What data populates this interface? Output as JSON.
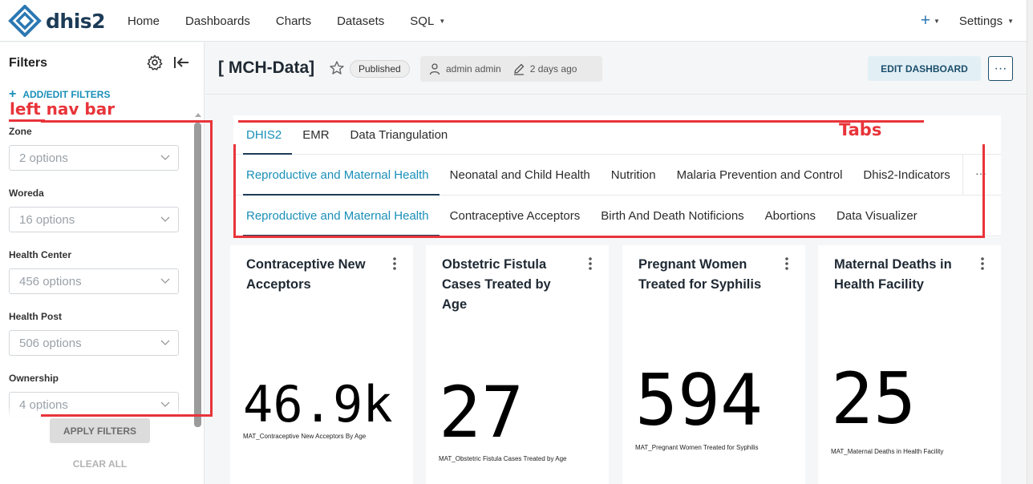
{
  "app": {
    "logo_text": "dhis2",
    "nav": [
      "Home",
      "Dashboards",
      "Charts",
      "Datasets",
      "SQL"
    ],
    "plus_label": "+",
    "settings_label": "Settings"
  },
  "sidebar": {
    "title": "Filters",
    "add_filters_label": "ADD/EDIT FILTERS",
    "annotation": "left nav bar",
    "filters": [
      {
        "label": "Zone",
        "value": "2 options"
      },
      {
        "label": "Woreda",
        "value": "16 options"
      },
      {
        "label": "Health Center",
        "value": "456 options"
      },
      {
        "label": "Health Post",
        "value": "506 options"
      },
      {
        "label": "Ownership",
        "value": "4 options"
      }
    ],
    "apply_label": "APPLY FILTERS",
    "clear_label": "CLEAR ALL"
  },
  "header": {
    "title": "[ MCH-Data]",
    "status": "Published",
    "owner": "admin admin",
    "modified": "2 days ago",
    "edit_label": "EDIT DASHBOARD",
    "more_label": "···"
  },
  "tabs": {
    "annotation": "Tabs",
    "row1": [
      "DHIS2",
      "EMR",
      "Data Triangulation"
    ],
    "row2": [
      "Reproductive and Maternal Health",
      "Neonatal and Child Health",
      "Nutrition",
      "Malaria Prevention and Control",
      "Dhis2-Indicators"
    ],
    "row2_more": "···",
    "row3": [
      "Reproductive and Maternal Health",
      "Contraceptive Acceptors",
      "Birth And Death Notificions",
      "Abortions",
      "Data Visualizer"
    ]
  },
  "cards": [
    {
      "title": "Contraceptive New Acceptors",
      "value": "46.9k",
      "subtitle": "MAT_Contraceptive New Acceptors By Age"
    },
    {
      "title": "Obstetric Fistula Cases Treated by Age",
      "value": "27",
      "subtitle": "MAT_Obstetric Fistula Cases Treated by Age"
    },
    {
      "title": "Pregnant Women Treated for Syphilis",
      "value": "594",
      "subtitle": "MAT_Pregnant Women Treated for Syphilis"
    },
    {
      "title": "Maternal Deaths in Health Facility",
      "value": "25",
      "subtitle": "MAT_Maternal Deaths in Health Facility"
    }
  ],
  "colors": {
    "accent": "#1a8fb8",
    "brand": "#1c3b57",
    "annotation_red": "#e8343a"
  }
}
